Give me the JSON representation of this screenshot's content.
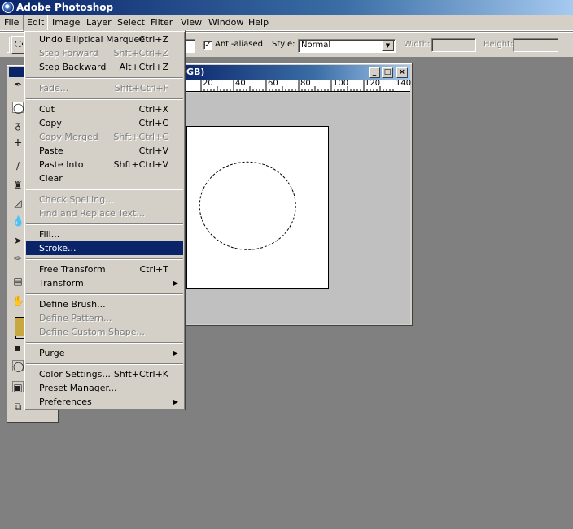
{
  "app": {
    "title": "Adobe Photoshop"
  },
  "menubar": [
    "File",
    "Edit",
    "Image",
    "Layer",
    "Select",
    "Filter",
    "View",
    "Window",
    "Help"
  ],
  "options": {
    "anti_aliased_label": "Anti-aliased",
    "anti_aliased_checked": true,
    "style_label": "Style:",
    "style_value": "Normal",
    "width_label": "Width:",
    "height_label": "Height:"
  },
  "document": {
    "title_fragment": "GB)",
    "ruler_labels": [
      "20",
      "40",
      "60",
      "80",
      "100",
      "120",
      "140"
    ]
  },
  "edit_menu": {
    "groups": [
      [
        {
          "label": "Undo Elliptical Marquee",
          "shortcut": "Ctrl+Z",
          "disabled": false
        },
        {
          "label": "Step Forward",
          "shortcut": "Shft+Ctrl+Z",
          "disabled": true
        },
        {
          "label": "Step Backward",
          "shortcut": "Alt+Ctrl+Z",
          "disabled": false
        }
      ],
      [
        {
          "label": "Fade...",
          "shortcut": "Shft+Ctrl+F",
          "disabled": true
        }
      ],
      [
        {
          "label": "Cut",
          "shortcut": "Ctrl+X",
          "disabled": false
        },
        {
          "label": "Copy",
          "shortcut": "Ctrl+C",
          "disabled": false
        },
        {
          "label": "Copy Merged",
          "shortcut": "Shft+Ctrl+C",
          "disabled": true
        },
        {
          "label": "Paste",
          "shortcut": "Ctrl+V",
          "disabled": false
        },
        {
          "label": "Paste Into",
          "shortcut": "Shft+Ctrl+V",
          "disabled": false
        },
        {
          "label": "Clear",
          "shortcut": "",
          "disabled": false
        }
      ],
      [
        {
          "label": "Check Spelling...",
          "shortcut": "",
          "disabled": true
        },
        {
          "label": "Find and Replace Text...",
          "shortcut": "",
          "disabled": true
        }
      ],
      [
        {
          "label": "Fill...",
          "shortcut": "",
          "disabled": false
        },
        {
          "label": "Stroke...",
          "shortcut": "",
          "disabled": false,
          "selected": true
        }
      ],
      [
        {
          "label": "Free Transform",
          "shortcut": "Ctrl+T",
          "disabled": false
        },
        {
          "label": "Transform",
          "shortcut": "",
          "disabled": false,
          "submenu": true
        }
      ],
      [
        {
          "label": "Define Brush...",
          "shortcut": "",
          "disabled": false
        },
        {
          "label": "Define Pattern...",
          "shortcut": "",
          "disabled": true
        },
        {
          "label": "Define Custom Shape...",
          "shortcut": "",
          "disabled": true
        }
      ],
      [
        {
          "label": "Purge",
          "shortcut": "",
          "disabled": false,
          "submenu": true
        }
      ],
      [
        {
          "label": "Color Settings...",
          "shortcut": "Shft+Ctrl+K",
          "disabled": false
        },
        {
          "label": "Preset Manager...",
          "shortcut": "",
          "disabled": false
        },
        {
          "label": "Preferences",
          "shortcut": "",
          "disabled": false,
          "submenu": true
        }
      ]
    ]
  },
  "colors": {
    "selection": "#0a246a",
    "chrome": "#d4d0c8",
    "workspace": "#808080",
    "foreground_swatch": "#c8a640"
  }
}
